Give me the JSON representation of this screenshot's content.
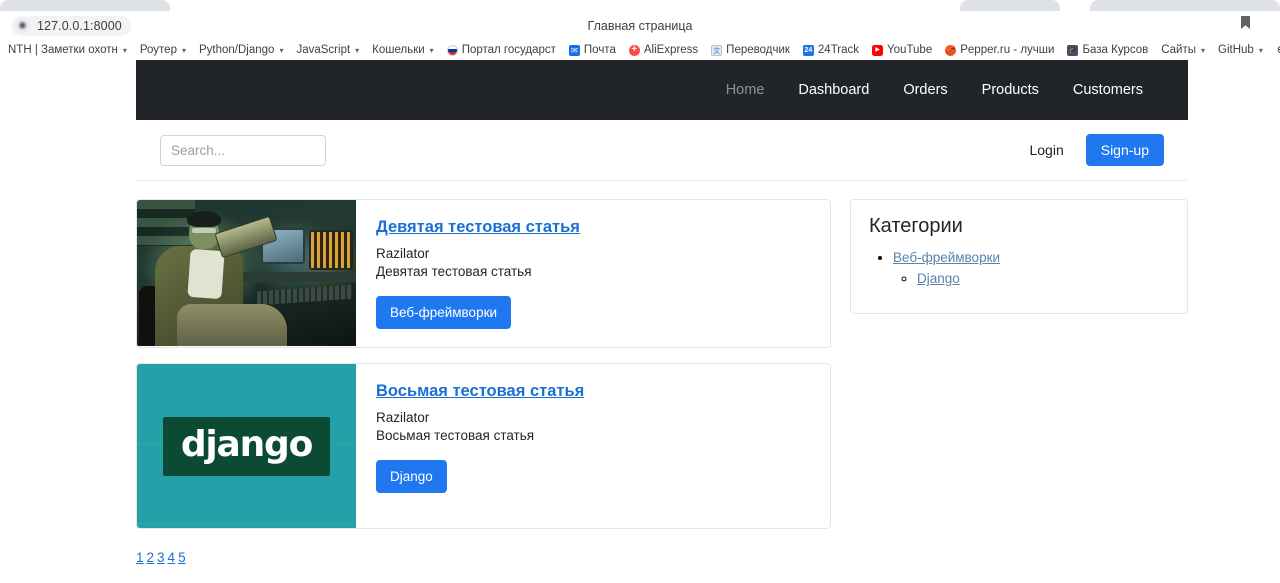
{
  "browser": {
    "url": "127.0.0.1:8000",
    "site_icon": "globe-icon",
    "page_title": "Главная страница",
    "bookmark_star": "bookmark-icon",
    "bookmarks": [
      {
        "label": "NTH | Заметки охотн",
        "icon": "none",
        "has_chevron": true
      },
      {
        "label": "Роутер",
        "icon": "none",
        "has_chevron": true
      },
      {
        "label": "Python/Django",
        "icon": "none",
        "has_chevron": true
      },
      {
        "label": "JavaScript",
        "icon": "none",
        "has_chevron": true
      },
      {
        "label": "Кошельки",
        "icon": "none",
        "has_chevron": true
      },
      {
        "label": "Портал государст",
        "icon": "fav-ru",
        "has_chevron": false
      },
      {
        "label": "Почта",
        "icon": "fav-mail",
        "has_chevron": false
      },
      {
        "label": "AliExpress",
        "icon": "fav-ali",
        "has_chevron": false
      },
      {
        "label": "Переводчик",
        "icon": "fav-trans",
        "has_chevron": false
      },
      {
        "label": "24Track",
        "icon": "fav-24",
        "has_chevron": false
      },
      {
        "label": "YouTube",
        "icon": "fav-yt",
        "has_chevron": false
      },
      {
        "label": "Pepper.ru - лучши",
        "icon": "fav-pepper",
        "has_chevron": false
      },
      {
        "label": "База Курсов",
        "icon": "fav-kursy",
        "has_chevron": false
      },
      {
        "label": "Сайты",
        "icon": "none",
        "has_chevron": true
      },
      {
        "label": "GitHub",
        "icon": "none",
        "has_chevron": true
      },
      {
        "label": "Cust",
        "icon": "fav-cust",
        "has_chevron": false
      }
    ]
  },
  "navbar": {
    "background": "#212529",
    "links": [
      {
        "label": "Home",
        "active": true
      },
      {
        "label": "Dashboard",
        "active": false
      },
      {
        "label": "Orders",
        "active": false
      },
      {
        "label": "Products",
        "active": false
      },
      {
        "label": "Customers",
        "active": false
      }
    ]
  },
  "search": {
    "placeholder": "Search...",
    "value": ""
  },
  "auth": {
    "login_label": "Login",
    "signup_label": "Sign-up",
    "signup_color": "#1f78f0"
  },
  "articles": [
    {
      "title": "Девятая тестовая статья",
      "author": "Razilator",
      "excerpt": "Девятая тестовая статья",
      "tag": "Веб-фреймворки",
      "thumbnail": "hacker-photo"
    },
    {
      "title": "Восьмая тестовая статья",
      "author": "Razilator",
      "excerpt": "Восьмая тестовая статья",
      "tag": "Django",
      "thumbnail": "django-logo"
    }
  ],
  "django_logo": {
    "wordmark": "django",
    "bg": "#26a0a8",
    "box": "#0c4b33"
  },
  "pagination": {
    "pages": [
      "1",
      "2",
      "3",
      "4",
      "5"
    ]
  },
  "sidebar": {
    "title": "Категории",
    "categories": [
      {
        "label": "Веб-фреймворки",
        "children": [
          {
            "label": "Django"
          }
        ]
      }
    ]
  }
}
